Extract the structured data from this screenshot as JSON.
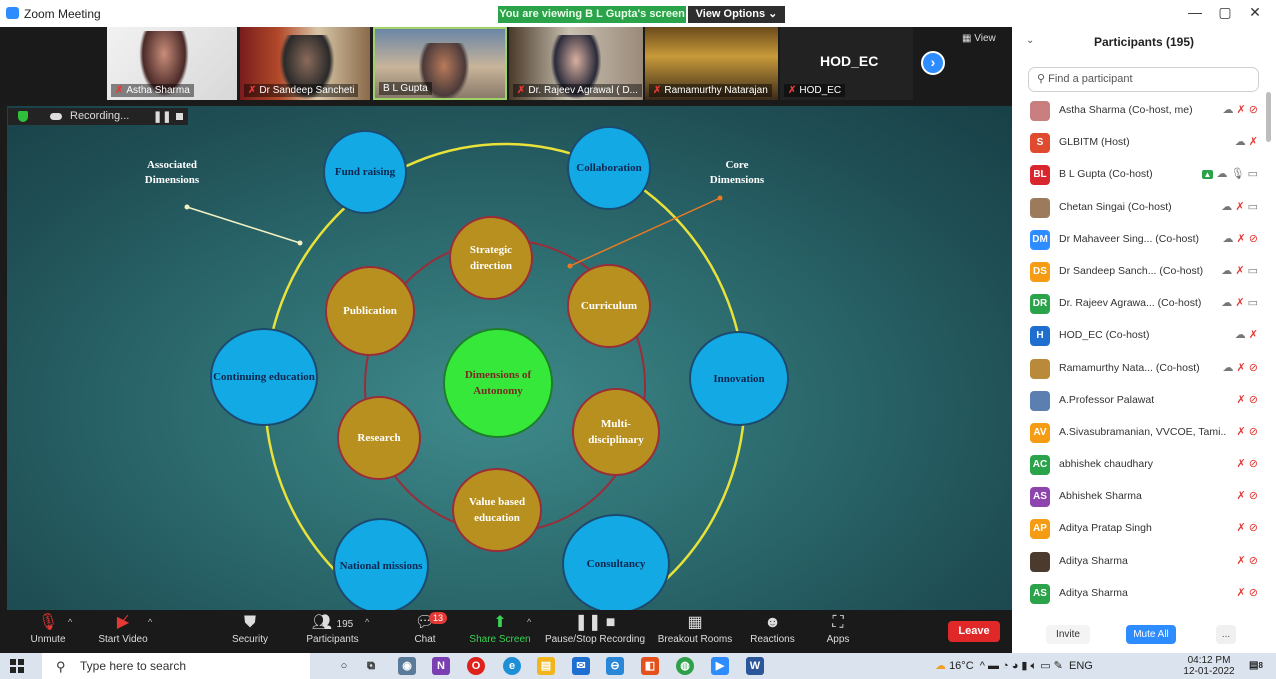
{
  "window": {
    "title": "Zoom Meeting",
    "share_banner": "You are viewing B L Gupta's screen",
    "view_options": "View Options ⌄",
    "controls": [
      "—",
      "▢",
      "✕"
    ]
  },
  "video_strip": {
    "tiles": [
      {
        "name": "Astha Sharma",
        "muted": true
      },
      {
        "name": "Dr Sandeep Sancheti",
        "muted": true
      },
      {
        "name": "B L Gupta",
        "muted": false
      },
      {
        "name": "Dr. Rajeev Agrawal ( D...",
        "muted": true
      },
      {
        "name": "Ramamurthy Natarajan",
        "muted": true
      },
      {
        "name": "HOD_EC",
        "muted": true,
        "label": "HOD_EC"
      }
    ],
    "view_label": "View"
  },
  "recording": {
    "label": "Recording..."
  },
  "slide": {
    "center": "Dimensions of Autonomy",
    "inner": [
      "Strategic direction",
      "Curriculum",
      "Multi-disciplinary",
      "Value based education",
      "Research",
      "Publication"
    ],
    "outer": [
      "Fund raising",
      "Collaboration",
      "Innovation",
      "Consultancy",
      "National missions",
      "Continuing education"
    ],
    "annotation_left": "Associated Dimensions",
    "annotation_right": "Core Dimensions",
    "colors": {
      "outer": "#12a9e4",
      "inner": "#b8901f",
      "center": "#36e83a",
      "ring": "#e8e23a"
    }
  },
  "toolbar": {
    "unmute": "Unmute",
    "start_video": "Start Video",
    "security": "Security",
    "participants": "Participants",
    "participants_count": "195",
    "chat": "Chat",
    "chat_badge": "13",
    "share_screen": "Share Screen",
    "pause_stop_recording": "Pause/Stop Recording",
    "breakout_rooms": "Breakout Rooms",
    "reactions": "Reactions",
    "apps": "Apps",
    "leave": "Leave"
  },
  "participants_panel": {
    "title": "Participants (195)",
    "search_placeholder": "Find a participant",
    "participants": [
      {
        "name": "Astha Sharma (Co-host, me)",
        "avatar": "",
        "color": "#c97f7f",
        "status": "cloud mute video-off"
      },
      {
        "name": "GLBITM (Host)",
        "avatar": "S",
        "color": "#e04a2e",
        "status": "cloud mute"
      },
      {
        "name": "B L Gupta (Co-host)",
        "avatar": "BL",
        "color": "#d9262e",
        "status": "share cloud mic video"
      },
      {
        "name": "Chetan Singai (Co-host)",
        "avatar": "",
        "color": "#9c7a5c",
        "status": "cloud mute video"
      },
      {
        "name": "Dr Mahaveer Sing... (Co-host)",
        "avatar": "DM",
        "color": "#2d8cff",
        "status": "cloud mute video-off"
      },
      {
        "name": "Dr Sandeep Sanch... (Co-host)",
        "avatar": "DS",
        "color": "#f59b14",
        "status": "cloud mute video"
      },
      {
        "name": "Dr. Rajeev Agrawa... (Co-host)",
        "avatar": "DR",
        "color": "#2aa34a",
        "status": "cloud mute video"
      },
      {
        "name": "HOD_EC (Co-host)",
        "avatar": "H",
        "color": "#1f6fd1",
        "status": "cloud mute"
      },
      {
        "name": "Ramamurthy Nata... (Co-host)",
        "avatar": "",
        "color": "#b88a3a",
        "status": "cloud mute video-off"
      },
      {
        "name": "A.Professor Palawat",
        "avatar": "",
        "color": "#5a7fb0",
        "status": "mute video-off"
      },
      {
        "name": "A.Sivasubramanian, VVCOE, Tami...",
        "avatar": "AV",
        "color": "#f59b14",
        "status": "mute video-off"
      },
      {
        "name": "abhishek chaudhary",
        "avatar": "AC",
        "color": "#2aa34a",
        "status": "mute video-off"
      },
      {
        "name": "Abhishek Sharma",
        "avatar": "AS",
        "color": "#8e44ad",
        "status": "mute video-off"
      },
      {
        "name": "Aditya Pratap Singh",
        "avatar": "AP",
        "color": "#f59b14",
        "status": "mute video-off"
      },
      {
        "name": "Aditya Sharma",
        "avatar": "",
        "color": "#4b3a2e",
        "status": "mute video-off"
      },
      {
        "name": "Aditya Sharma",
        "avatar": "AS",
        "color": "#2aa34a",
        "status": "mute video-off"
      }
    ],
    "invite": "Invite",
    "mute_all": "Mute All",
    "more": "..."
  },
  "taskbar": {
    "search_placeholder": "Type here to search",
    "weather": "16°C",
    "lang": "ENG",
    "time": "04:12 PM",
    "date": "12-01-2022",
    "notif_count": "8"
  }
}
